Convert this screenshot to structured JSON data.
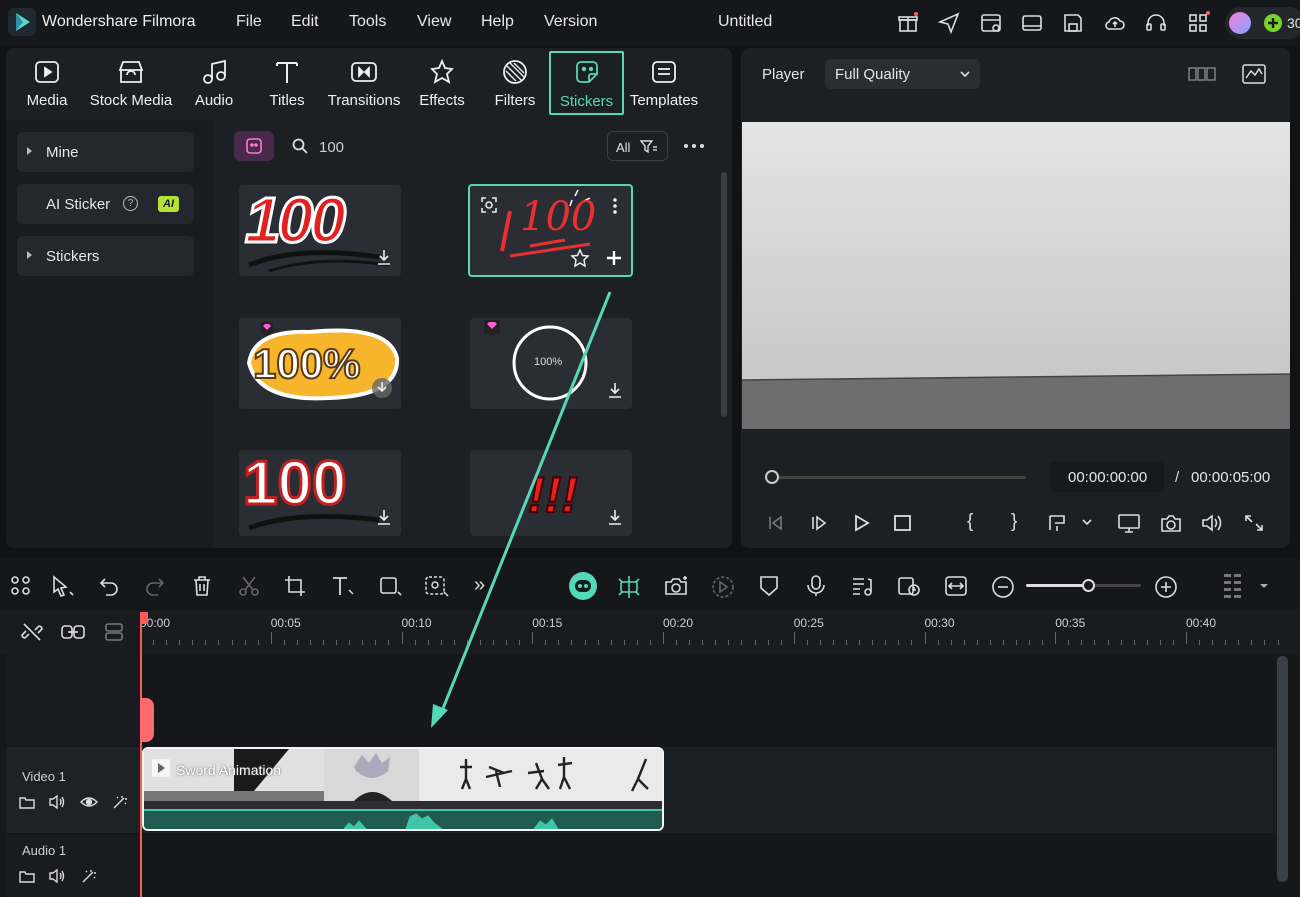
{
  "app": {
    "name": "Wondershare Filmora",
    "doc_title": "Untitled",
    "credits": "30"
  },
  "menu": [
    "File",
    "Edit",
    "Tools",
    "View",
    "Help",
    "Version"
  ],
  "categories": [
    {
      "label": "Media",
      "icon": "media-icon"
    },
    {
      "label": "Stock Media",
      "icon": "stock-media-icon"
    },
    {
      "label": "Audio",
      "icon": "audio-icon"
    },
    {
      "label": "Titles",
      "icon": "titles-icon"
    },
    {
      "label": "Transitions",
      "icon": "transitions-icon"
    },
    {
      "label": "Effects",
      "icon": "effects-icon"
    },
    {
      "label": "Filters",
      "icon": "filters-icon"
    },
    {
      "label": "Stickers",
      "icon": "stickers-icon",
      "active": true
    },
    {
      "label": "Templates",
      "icon": "templates-icon"
    }
  ],
  "sidebar": {
    "items": [
      {
        "label": "Mine"
      },
      {
        "label": "AI Sticker",
        "badge": "AI"
      },
      {
        "label": "Stickers"
      }
    ]
  },
  "search": {
    "value": "100",
    "filter_label": "All"
  },
  "stickers": [
    {
      "text": "100",
      "style": "red"
    },
    {
      "text": "100",
      "style": "handwritten",
      "selected": true
    },
    {
      "text": "100%",
      "style": "yellow",
      "premium": true
    },
    {
      "text": "100%",
      "style": "circle",
      "premium": true
    },
    {
      "text": "100",
      "style": "white"
    },
    {
      "text": "!!!",
      "style": "exclaim"
    }
  ],
  "player": {
    "label": "Player",
    "quality": "Full Quality",
    "current_time": "00:00:00:00",
    "separator": "/",
    "total_time": "00:00:05:00"
  },
  "timeline": {
    "ruler": [
      "00:00",
      "00:05",
      "00:10",
      "00:15",
      "00:20",
      "00:25",
      "00:30",
      "00:35",
      "00:40"
    ],
    "tracks": [
      {
        "label": "Video 1"
      },
      {
        "label": "Audio 1"
      }
    ],
    "clip": {
      "title": "Sword Animation"
    },
    "zoom_level": 0.55
  },
  "colors": {
    "accent": "#54d8b8",
    "playhead": "#ff5a5a",
    "bg": "#101216",
    "panel": "#1c1f24"
  }
}
